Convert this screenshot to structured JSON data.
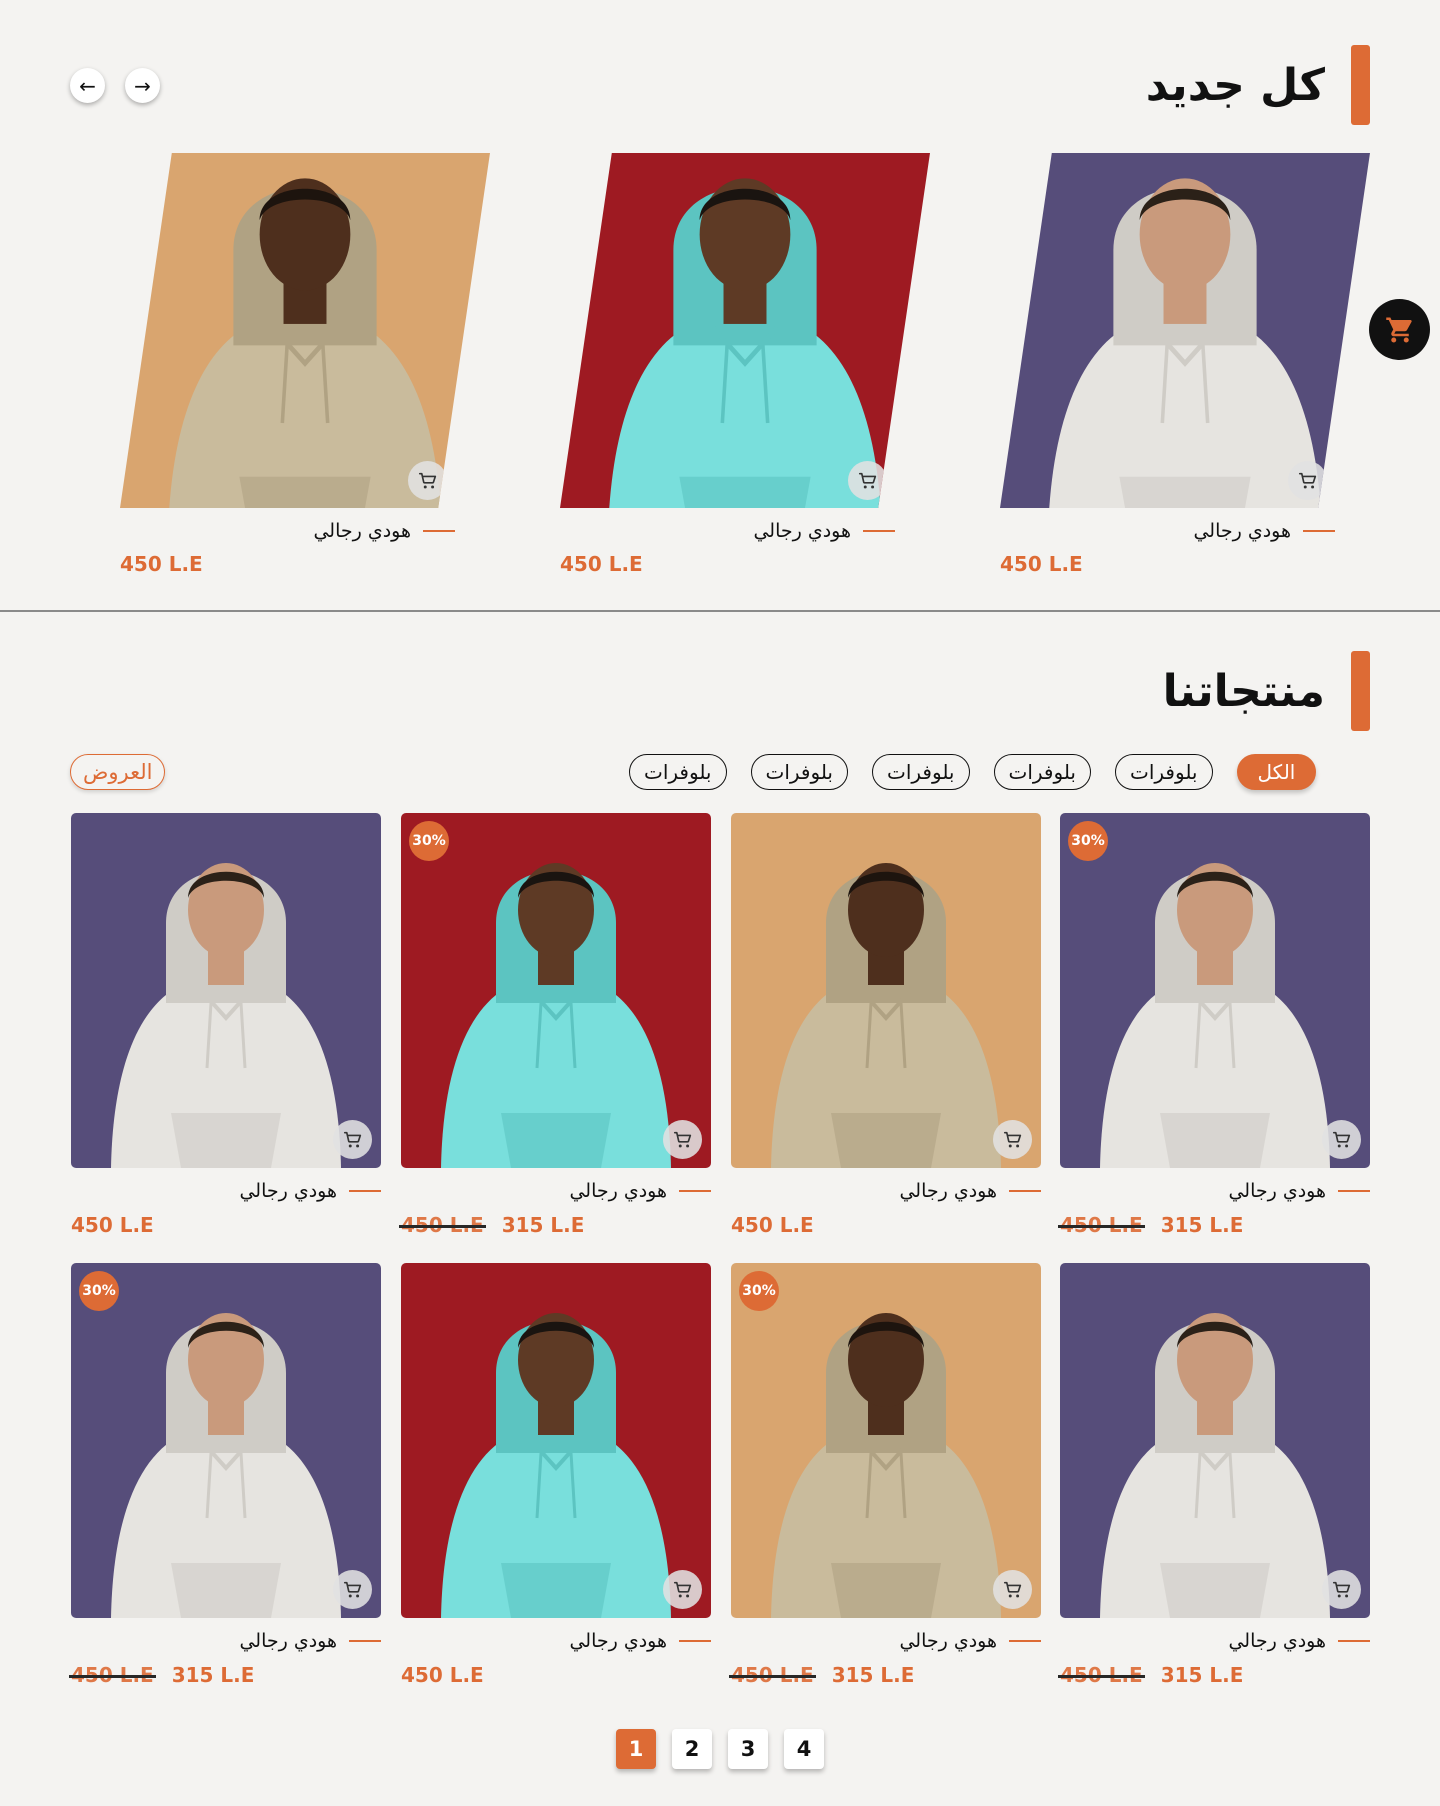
{
  "colors": {
    "accent": "#dd6b35",
    "purple": "#564d7a",
    "red": "#9e1a22",
    "tan": "#d9a56f"
  },
  "new_section": {
    "title": "كل جديد",
    "prev_arrow": "←",
    "next_arrow": "→"
  },
  "new_products": [
    {
      "name": "هودي رجالي",
      "price": "450 L.E",
      "style": "white"
    },
    {
      "name": "هودي رجالي",
      "price": "450 L.E",
      "style": "cyan"
    },
    {
      "name": "هودي رجالي",
      "price": "450 L.E",
      "style": "beige"
    }
  ],
  "products_section": {
    "title": "منتجاتنا"
  },
  "filters": {
    "active": "الكل",
    "items": [
      "بلوفرات",
      "بلوفرات",
      "بلوفرات",
      "بلوفرات",
      "بلوفرات"
    ],
    "offers": "العروض"
  },
  "products": [
    {
      "name": "هودي رجالي",
      "style": "white",
      "badge": "30%",
      "old_price": "450 L.E",
      "price": "315 L.E"
    },
    {
      "name": "هودي رجالي",
      "style": "beige",
      "badge": "",
      "old_price": "",
      "price": "450 L.E"
    },
    {
      "name": "هودي رجالي",
      "style": "cyan",
      "badge": "30%",
      "old_price": "450 L.E",
      "price": "315 L.E"
    },
    {
      "name": "هودي رجالي",
      "style": "white",
      "badge": "",
      "old_price": "",
      "price": "450 L.E"
    },
    {
      "name": "هودي رجالي",
      "style": "white",
      "badge": "",
      "old_price": "450 L.E",
      "price": "315 L.E"
    },
    {
      "name": "هودي رجالي",
      "style": "beige",
      "badge": "30%",
      "old_price": "450 L.E",
      "price": "315 L.E"
    },
    {
      "name": "هودي رجالي",
      "style": "cyan",
      "badge": "",
      "old_price": "",
      "price": "450 L.E"
    },
    {
      "name": "هودي رجالي",
      "style": "white",
      "badge": "30%",
      "old_price": "450 L.E",
      "price": "315 L.E"
    }
  ],
  "pagination": {
    "pages": [
      "1",
      "2",
      "3",
      "4"
    ],
    "current": "1"
  }
}
